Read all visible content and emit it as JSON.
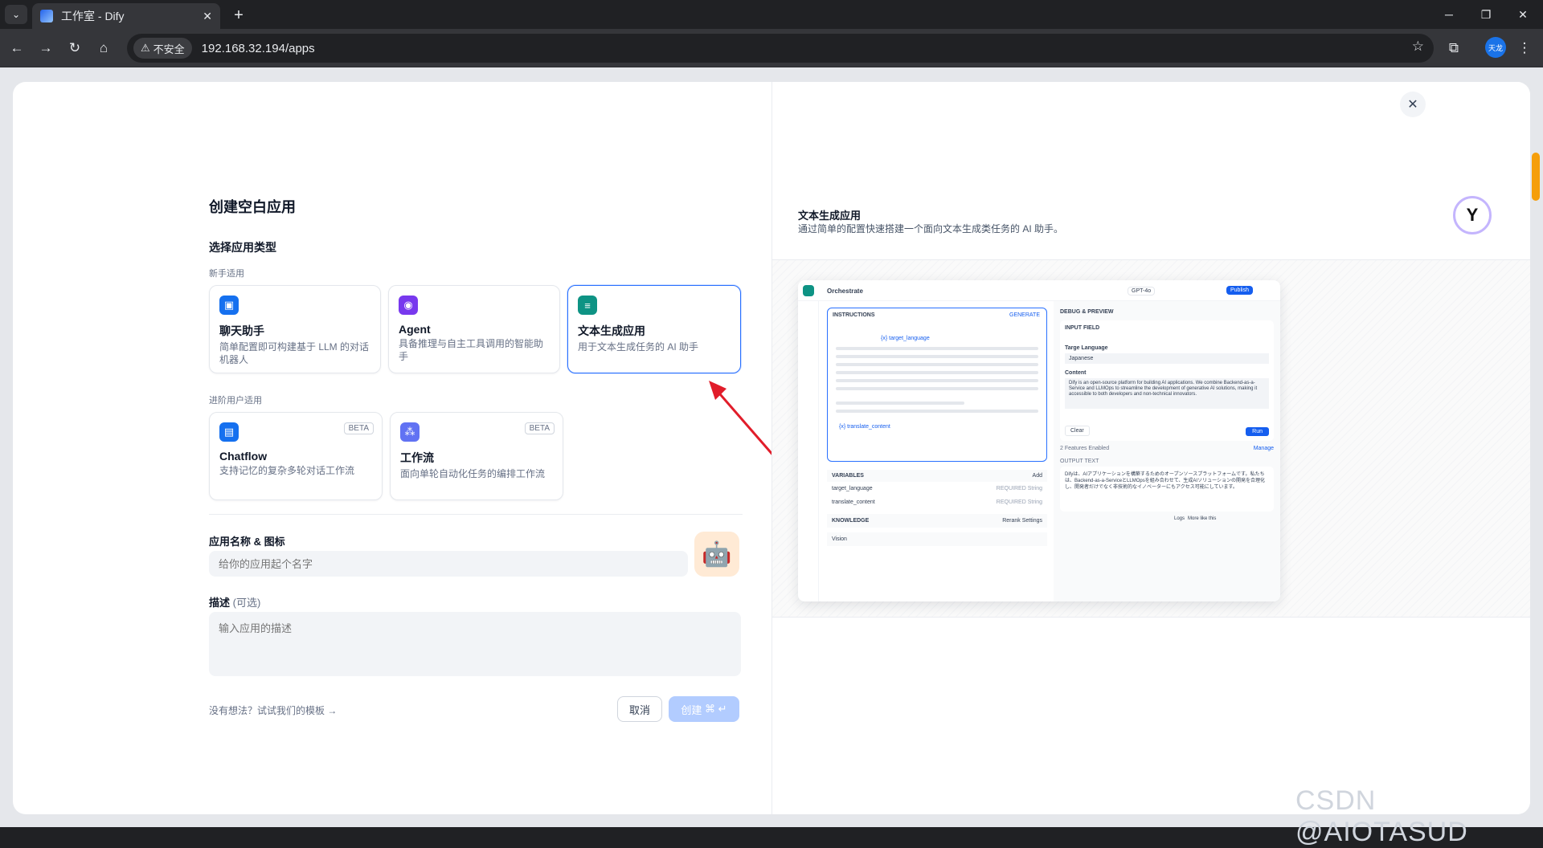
{
  "browser": {
    "tab_title": "工作室 - Dify",
    "security_label": "不安全",
    "url": "192.168.32.194/apps",
    "profile_initials": "天龙"
  },
  "left": {
    "heading": "创建空白应用",
    "type_heading": "选择应用类型",
    "beginner_label": "新手适用",
    "advanced_label": "进阶用户适用",
    "beginner_cards": [
      {
        "title": "聊天助手",
        "desc": "简单配置即可构建基于 LLM 的对话机器人",
        "icon": "chat-icon",
        "color": "#1570ef"
      },
      {
        "title": "Agent",
        "desc": "具备推理与自主工具调用的智能助手",
        "icon": "agent-icon",
        "color": "#7839ee"
      },
      {
        "title": "文本生成应用",
        "desc": "用于文本生成任务的 AI 助手",
        "icon": "text-generation-icon",
        "color": "#0e9384"
      }
    ],
    "advanced_cards": [
      {
        "title": "Chatflow",
        "desc": "支持记忆的复杂多轮对话工作流",
        "badge": "BETA",
        "icon": "chatflow-icon",
        "color": "#1570ef"
      },
      {
        "title": "工作流",
        "desc": "面向单轮自动化任务的编排工作流",
        "badge": "BETA",
        "icon": "workflow-icon",
        "color": "#6172f3"
      }
    ],
    "name_label": "应用名称 & 图标",
    "name_placeholder": "给你的应用起个名字",
    "desc_label": "描述",
    "desc_optional": "(可选)",
    "desc_placeholder": "输入应用的描述",
    "template_link": "没有想法？试试我们的模板",
    "cancel": "取消",
    "create": "创建"
  },
  "right": {
    "title": "文本生成应用",
    "desc": "通过简单的配置快速搭建一个面向文本生成类任务的 AI 助手。",
    "preview": {
      "orchestrate": "Orchestrate",
      "model": "GPT-4o",
      "publish": "Publish",
      "instructions": "INSTRUCTIONS",
      "generate": "GENERATE",
      "var1": "{x} target_language",
      "var2": "{x} translate_content",
      "debug": "DEBUG & PREVIEW",
      "input_field": "INPUT FIELD",
      "targe_language": "Targe Language",
      "japanese": "Japanese",
      "content": "Content",
      "content_text": "Dify is an open-source platform for building AI applications. We combine Backend-as-a-Service and LLMOps to streamline the development of generative AI solutions, making it accessible to both developers and non-technical innovators.",
      "clear": "Clear",
      "run": "Run",
      "variables": "VARIABLES",
      "add": "Add",
      "row1": "target_language",
      "row2": "translate_content",
      "required": "REQUIRED",
      "string": "String",
      "knowledge": "KNOWLEDGE",
      "rerank": "Rerank Settings",
      "vision": "Vision",
      "features": "2 Features Enabled",
      "manage": "Manage",
      "output_text": "OUTPUT TEXT",
      "output": "Difyは、AIアプリケーションを構築するためのオープンソースプラットフォームです。私たちは、Backend-as-a-ServiceとLLMOpsを組み合わせて、生成AIソリューションの開発を合理化し、開発者だけでなく非技術的なイノベーターにもアクセス可能にしています。",
      "logs": "Logs",
      "more_like": "More like this"
    }
  },
  "watermark": "CSDN @AIOTASUD"
}
